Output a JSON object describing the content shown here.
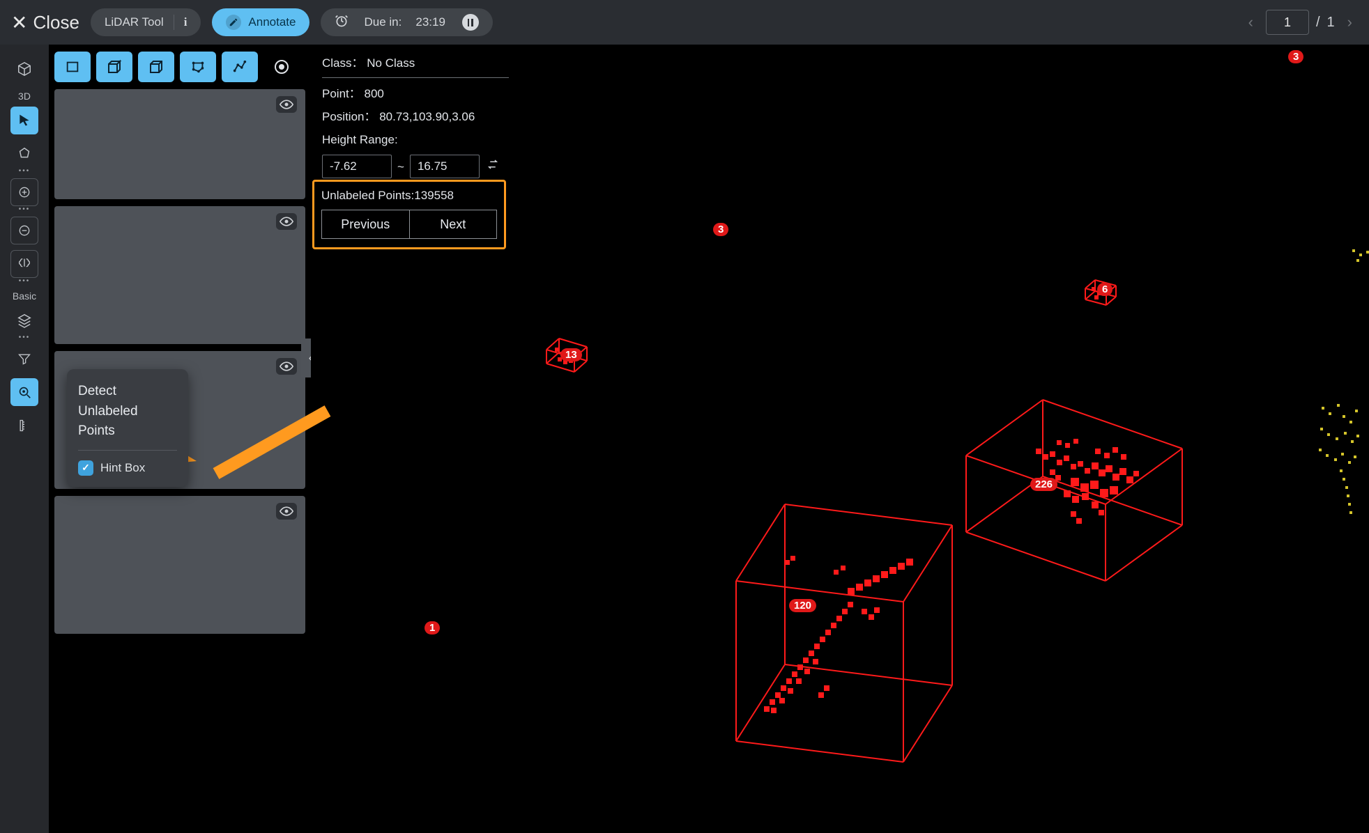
{
  "topbar": {
    "close_label": "Close",
    "tool_name": "LiDAR Tool",
    "annotate_label": "Annotate",
    "due_label": "Due in:",
    "due_time": "23:19"
  },
  "pager": {
    "current": "1",
    "total": "1",
    "sep": "/"
  },
  "rail": {
    "label_3d": "3D",
    "label_basic": "Basic"
  },
  "info": {
    "class_label": "Class：",
    "class_value": "No Class",
    "point_label": "Point：",
    "point_value": "800",
    "position_label": "Position：",
    "position_value": "80.73,103.90,3.06",
    "height_label": "Height Range:",
    "range_min": "-7.62",
    "range_max": "16.75"
  },
  "unlabeled": {
    "label": "Unlabeled Points:",
    "value": "139558",
    "prev": "Previous",
    "next": "Next"
  },
  "tooltip": {
    "title": "Detect Unlabeled Points",
    "hintbox_label": "Hint Box"
  },
  "badges": {
    "b1": "3",
    "b2": "6",
    "b3": "13",
    "b4": "226",
    "b5": "120",
    "b6": "1",
    "b7": "3"
  }
}
